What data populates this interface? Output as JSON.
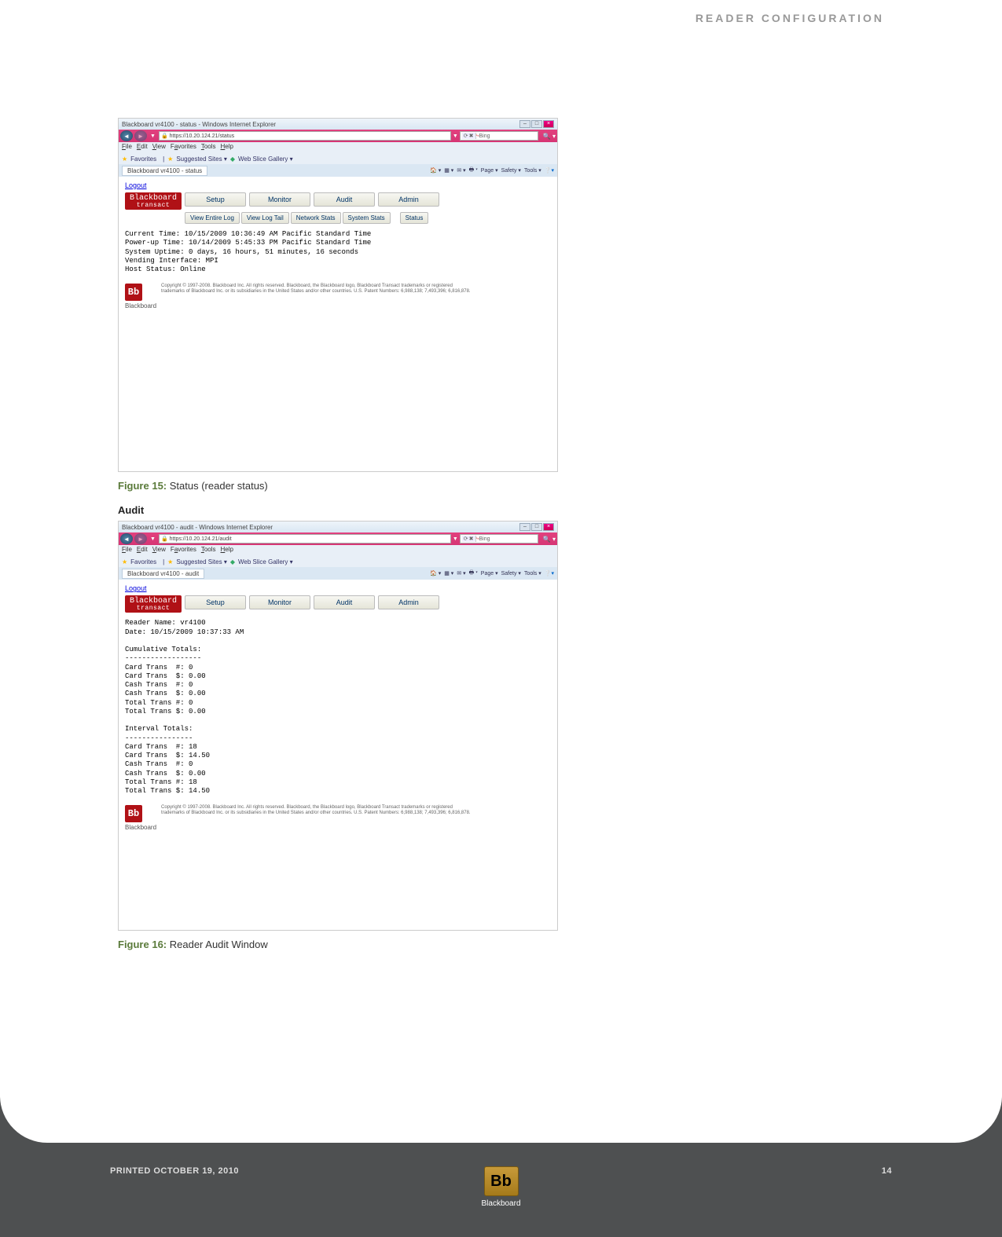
{
  "page_header": "READER  CONFIGURATION",
  "screenshots": [
    {
      "title": "Blackboard vr4100 - status - Windows Internet Explorer",
      "url_display": "https://10.20.124.21/status",
      "search_engine": "Bing",
      "menu": [
        "File",
        "Edit",
        "View",
        "Favorites",
        "Tools",
        "Help"
      ],
      "favbar": {
        "favorites": "Favorites",
        "suggested": "Suggested Sites",
        "slice": "Web Slice Gallery"
      },
      "tab_label": "Blackboard vr4100 - status",
      "toolbar_items": [
        "Page",
        "Safety",
        "Tools"
      ],
      "logout": "Logout",
      "brand": {
        "line1": "Blackboard",
        "line2": "transact"
      },
      "main_tabs": [
        "Setup",
        "Monitor",
        "Audit",
        "Admin"
      ],
      "sub_tabs": [
        "View Entire Log",
        "View Log Tail",
        "Network Stats",
        "System Stats",
        "Status"
      ],
      "status_text": "Current Time: 10/15/2009 10:36:49 AM Pacific Standard Time\nPower-up Time: 10/14/2009 5:45:33 PM Pacific Standard Time\nSystem Uptime: 0 days, 16 hours, 51 minutes, 16 seconds\nVending Interface: MPI\nHost Status: Online",
      "bb_sq": "Bb",
      "copyright": "Copyright © 1997-2008. Blackboard Inc. All rights reserved. Blackboard, the Blackboard logo, Blackboard Transact  trademarks or registered trademarks of Blackboard Inc. or its subsidiaries in the United States and/or other countries. U.S. Patent Numbers: 6,988,138; 7,493,396; 6,816,878.",
      "foot_label": "Blackboard"
    },
    {
      "title": "Blackboard vr4100 - audit - Windows Internet Explorer",
      "url_display": "https://10.20.124.21/audit",
      "search_engine": "Bing",
      "menu": [
        "File",
        "Edit",
        "View",
        "Favorites",
        "Tools",
        "Help"
      ],
      "favbar": {
        "favorites": "Favorites",
        "suggested": "Suggested Sites",
        "slice": "Web Slice Gallery"
      },
      "tab_label": "Blackboard vr4100 - audit",
      "toolbar_items": [
        "Page",
        "Safety",
        "Tools"
      ],
      "logout": "Logout",
      "brand": {
        "line1": "Blackboard",
        "line2": "transact"
      },
      "main_tabs": [
        "Setup",
        "Monitor",
        "Audit",
        "Admin"
      ],
      "audit_text": "Reader Name: vr4100\nDate: 10/15/2009 10:37:33 AM\n\nCumulative Totals:\n------------------\nCard Trans  #: 0\nCard Trans  $: 0.00\nCash Trans  #: 0\nCash Trans  $: 0.00\nTotal Trans #: 0\nTotal Trans $: 0.00\n\nInterval Totals:\n----------------\nCard Trans  #: 18\nCard Trans  $: 14.50\nCash Trans  #: 0\nCash Trans  $: 0.00\nTotal Trans #: 18\nTotal Trans $: 14.50",
      "bb_sq": "Bb",
      "copyright": "Copyright © 1997-2008. Blackboard Inc. All rights reserved. Blackboard, the Blackboard logo, Blackboard Transact  trademarks or registered trademarks of Blackboard Inc. or its subsidiaries in the United States and/or other countries. U.S. Patent Numbers: 6,988,138; 7,493,396; 6,816,878.",
      "foot_label": "Blackboard"
    }
  ],
  "figure15": {
    "label": "Figure 15:",
    "title": "Status (reader status)"
  },
  "audit_heading": "Audit",
  "figure16": {
    "label": "Figure 16:",
    "title": "Reader Audit Window"
  },
  "footer": {
    "printed": "PRINTED OCTOBER 19, 2010",
    "page": "14",
    "brand": "Blackboard",
    "sq": "Bb"
  }
}
